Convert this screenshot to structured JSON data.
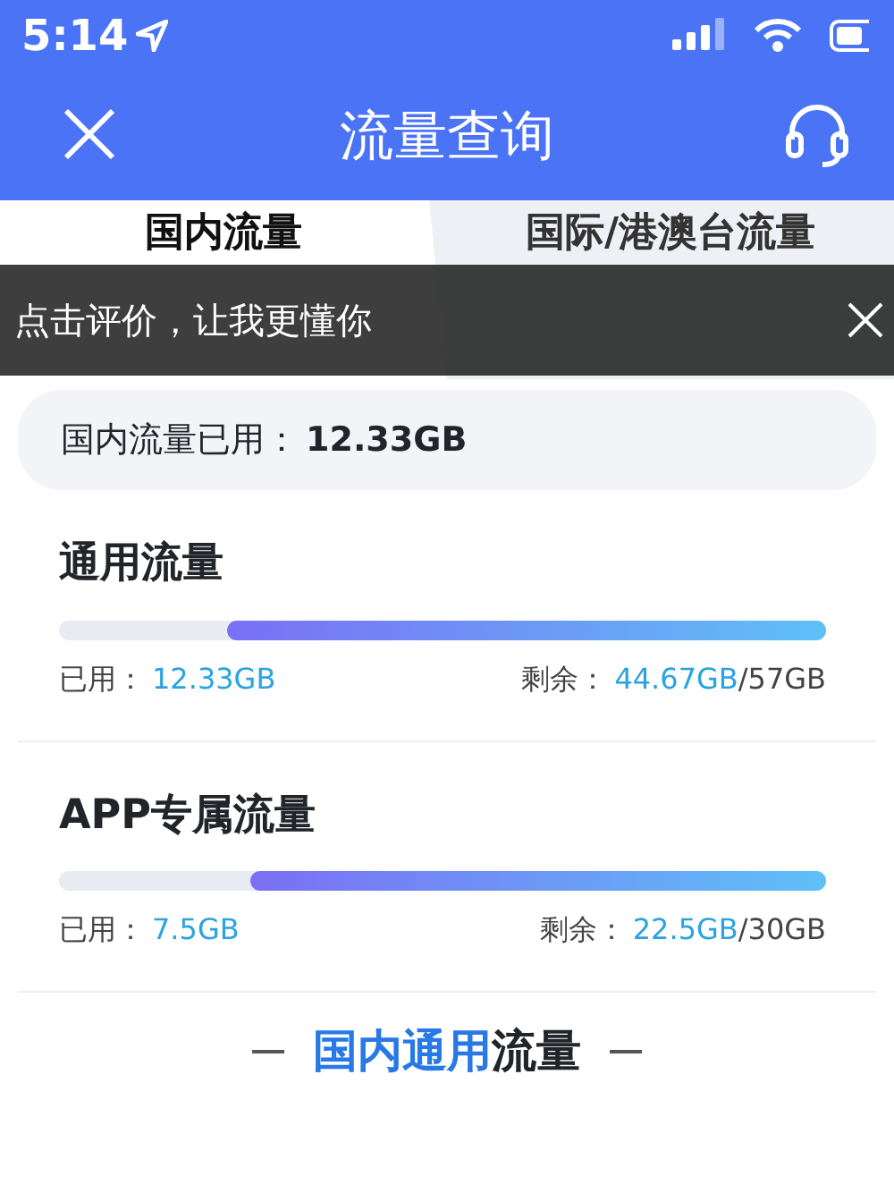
{
  "status_bar": {
    "time": "5:14"
  },
  "header": {
    "title": "流量查询"
  },
  "tabs": [
    {
      "label": "国内流量",
      "selected": true
    },
    {
      "label": "国际/港澳台流量",
      "selected": false
    }
  ],
  "toast": {
    "text": "点击评价，让我更懂你"
  },
  "summary": {
    "label": "国内流量已用：",
    "value": "12.33GB"
  },
  "plans": [
    {
      "name": "通用流量",
      "level": 0.78,
      "used_label": "已用：",
      "used": "12.33GB",
      "remain_label": "剩余：",
      "remain": "44.67GB",
      "total": "/57GB"
    },
    {
      "name": "APP专属流量",
      "level": 0.75,
      "used_label": "已用：",
      "used": "7.5GB",
      "remain_label": "剩余：",
      "remain": "22.5GB",
      "total": "/30GB"
    }
  ],
  "section": {
    "highlight": "国内通用",
    "rest": "流量"
  }
}
